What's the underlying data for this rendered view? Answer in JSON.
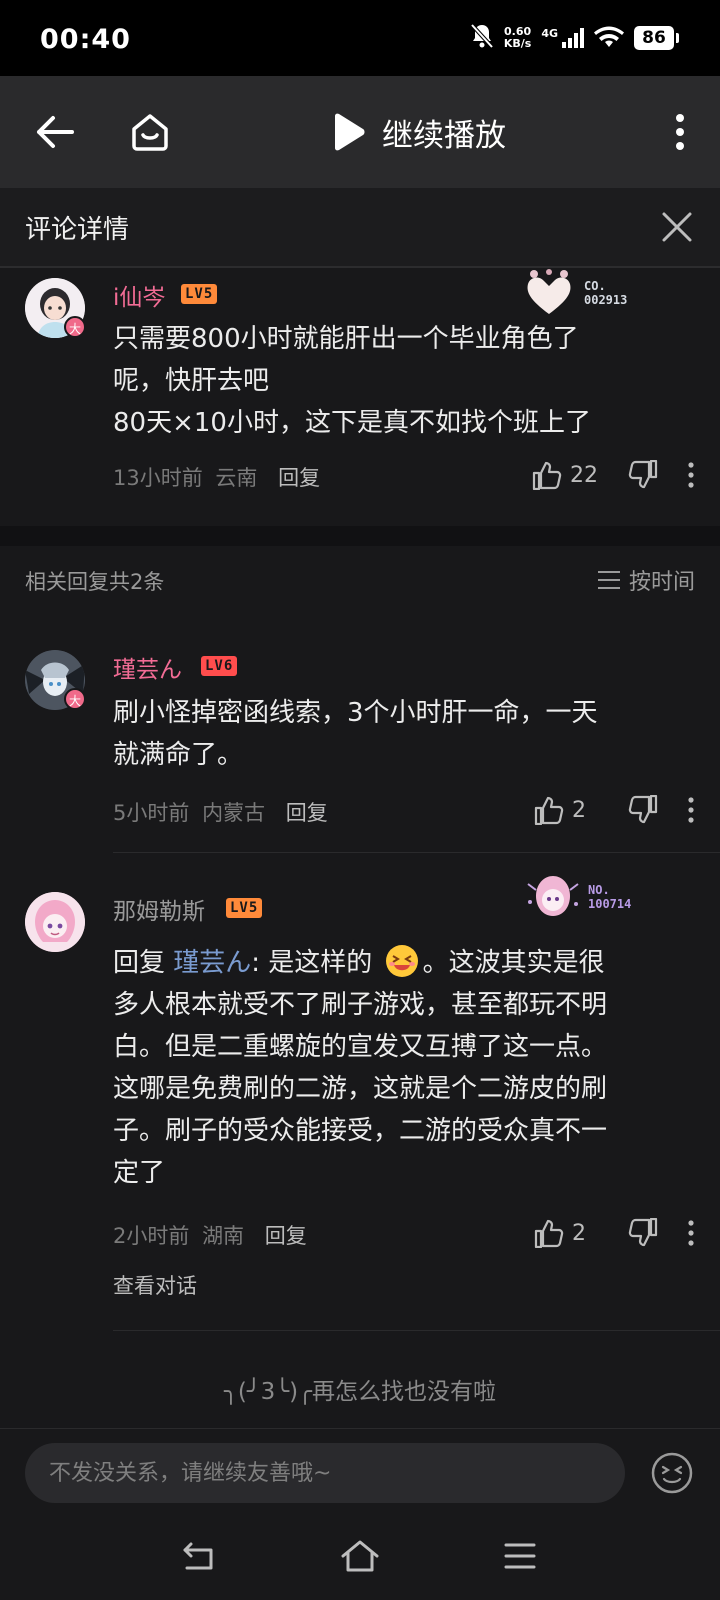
{
  "status": {
    "time": "00:40",
    "speed_value": "0.60",
    "speed_unit": "KB/s",
    "network": "4G",
    "battery": "86"
  },
  "topbar": {
    "continue_label": "继续播放"
  },
  "detail": {
    "title": "评论详情"
  },
  "main_comment": {
    "username": "i仙岑",
    "level": "LV5",
    "fan_badge": "大",
    "deco_line1": "CO.",
    "deco_line2": "002913",
    "text_line1": "只需要800小时就能肝出一个毕业角色了",
    "text_line2": "呢，快肝去吧",
    "text_line3": "80天×10小时，这下是真不如找个班上了",
    "time": "13小时前",
    "location": "云南",
    "reply_label": "回复",
    "likes": "22"
  },
  "related": {
    "count_label": "相关回复共2条",
    "sort_label": "按时间"
  },
  "replies": [
    {
      "username": "瑾芸ん",
      "level": "LV6",
      "fan_badge": "大",
      "text_line1": "刷小怪掉密函线索，3个小时肝一命，一天",
      "text_line2": "就满命了。",
      "time": "5小时前",
      "location": "内蒙古",
      "reply_label": "回复",
      "likes": "2"
    },
    {
      "username": "那姆勒斯",
      "level": "LV5",
      "deco_line1": "NO.",
      "deco_line2": "100714",
      "reply_prefix": "回复 ",
      "reply_target": "瑾芸ん",
      "text_head": ": 是这样的",
      "text_tail": "。这波其实是很",
      "text_line2": "多人根本就受不了刷子游戏，甚至都玩不明",
      "text_line3": "白。但是二重螺旋的宣发又互搏了这一点。",
      "text_line4": "这哪是免费刷的二游，这就是个二游皮的刷",
      "text_line5": "子。刷子的受众能接受，二游的受众真不一",
      "text_line6": "定了",
      "time": "2小时前",
      "location": "湖南",
      "reply_label": "回复",
      "likes": "2",
      "view_conversation": "查看对话"
    }
  ],
  "end_text": "╮(╯3╰)╭再怎么找也没有啦",
  "input": {
    "placeholder": "不发没关系，请继续友善哦~"
  },
  "colors": {
    "accent_pink": "#f26c95",
    "level5": "#ff8a3a",
    "level6": "#ff4d4d",
    "background": "#18181a"
  }
}
